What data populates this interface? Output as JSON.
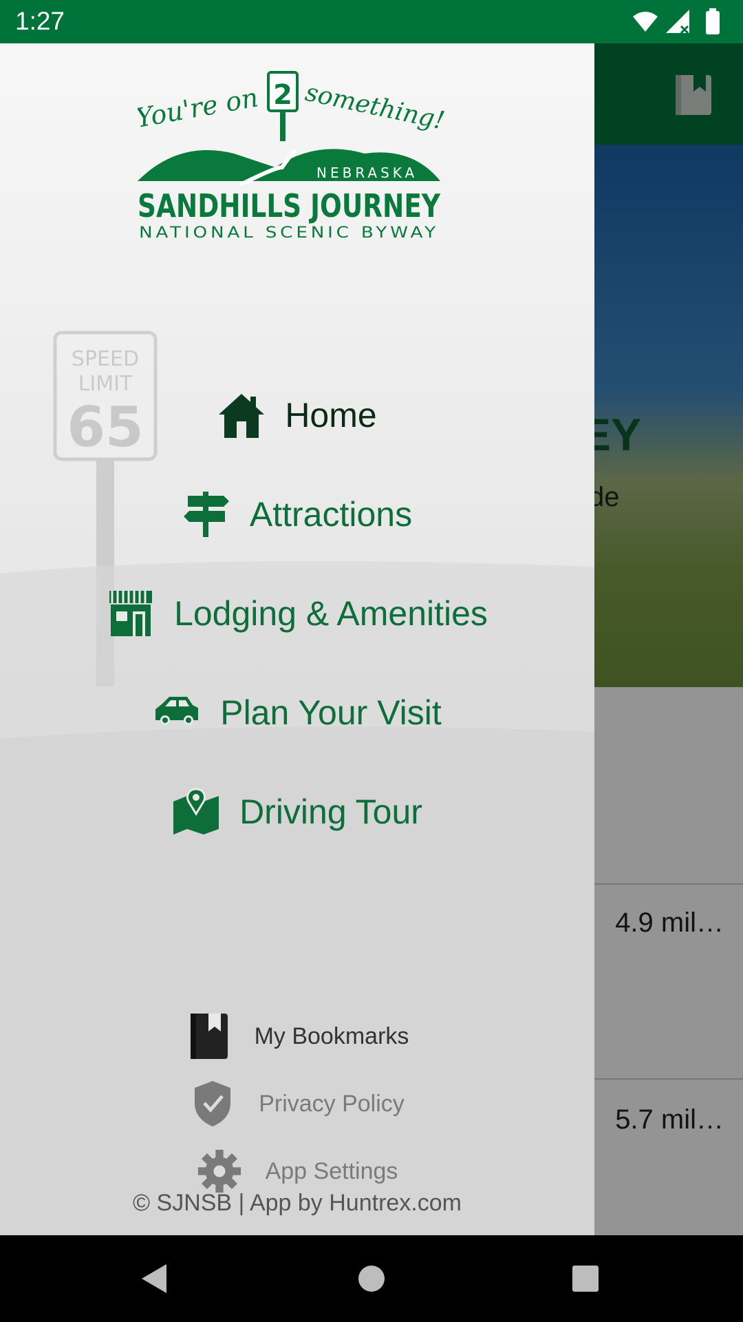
{
  "status_bar": {
    "time": "1:27",
    "icons": [
      "wifi-icon",
      "signal-icon",
      "battery-icon"
    ]
  },
  "background": {
    "hero_title_fragment": "EY",
    "hero_subtitle_fragment": "de",
    "list_rows": [
      {
        "distance": "4.9 mil…"
      },
      {
        "distance": "5.7 mil…"
      }
    ]
  },
  "drawer": {
    "logo": {
      "tagline": "You're on 2 something!",
      "route_number": "2",
      "state": "NEBRASKA",
      "name": "SANDHILLS JOURNEY",
      "subtitle": "NATIONAL SCENIC BYWAY"
    },
    "menu": [
      {
        "label": "Home",
        "icon": "home-icon",
        "active": true
      },
      {
        "label": "Attractions",
        "icon": "signpost-icon",
        "active": false
      },
      {
        "label": "Lodging & Amenities",
        "icon": "store-icon",
        "active": false
      },
      {
        "label": "Plan Your Visit",
        "icon": "car-icon",
        "active": false
      },
      {
        "label": "Driving Tour",
        "icon": "map-pin-icon",
        "active": false
      }
    ],
    "secondary": [
      {
        "label": "My Bookmarks",
        "icon": "bookmark-book-icon"
      },
      {
        "label": "Privacy Policy",
        "icon": "shield-check-icon"
      },
      {
        "label": "App Settings",
        "icon": "gear-icon"
      }
    ],
    "copyright": "© SJNSB | App by Huntrex.com"
  },
  "colors": {
    "brand_green": "#00733b",
    "menu_text": "#0d6e3a",
    "active_text": "#0b2a16"
  }
}
